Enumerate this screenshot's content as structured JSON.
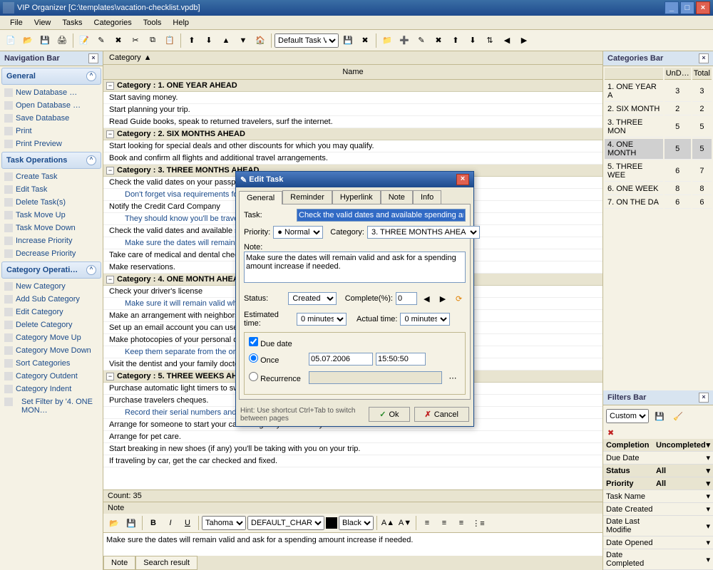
{
  "window": {
    "title": "VIP Organizer [C:\\templates\\vacation-checklist.vpdb]"
  },
  "menu": [
    "File",
    "View",
    "Tasks",
    "Categories",
    "Tools",
    "Help"
  ],
  "toolbar": {
    "taskview_label": "Default Task V"
  },
  "navbar": {
    "title": "Navigation Bar",
    "sections": {
      "general": {
        "title": "General",
        "items": [
          "New Database …",
          "Open Database …",
          "Save Database",
          "Print",
          "Print Preview"
        ]
      },
      "taskops": {
        "title": "Task Operations",
        "items": [
          "Create Task",
          "Edit Task",
          "Delete Task(s)",
          "Task Move Up",
          "Task Move Down",
          "Increase Priority",
          "Decrease Priority"
        ]
      },
      "catops": {
        "title": "Category Operati…",
        "items": [
          "New Category",
          "Add Sub Category",
          "Edit Category",
          "Delete Category",
          "Category Move Up",
          "Category Move Down",
          "Sort Categories",
          "Category Outdent",
          "Category Indent"
        ],
        "filter": "Set Filter by '4. ONE MON…"
      }
    }
  },
  "center": {
    "category_hdr": "Category",
    "name_col": "Name",
    "count": "Count: 35",
    "categories": [
      {
        "title": "Category : 1. ONE YEAR AHEAD",
        "tasks": [
          {
            "t": "Start saving money."
          },
          {
            "t": "Start planning your trip."
          },
          {
            "t": "Read Guide books, speak to returned travelers, surf the internet."
          }
        ]
      },
      {
        "title": "Category : 2. SIX MONTHS AHEAD",
        "tasks": [
          {
            "t": "Start looking for special deals and other discounts for which you may qualify."
          },
          {
            "t": "Book and confirm all flights and additional travel arrangements."
          }
        ]
      },
      {
        "title": "Category : 3. THREE MONTHS AHEAD",
        "tasks": [
          {
            "t": "Check the valid dates on your passport"
          },
          {
            "t": "Don't forget visa requirements for the co",
            "sub": true
          },
          {
            "t": "Notify the Credit Card Company"
          },
          {
            "t": "They should know you'll be traveling, so destination.",
            "sub": true
          },
          {
            "t": "Check the valid dates and available spendin"
          },
          {
            "t": "Make sure the dates will remain valid and needed.",
            "sub": true
          },
          {
            "t": "Take care of medical and dental checkups a"
          },
          {
            "t": "Make reservations."
          }
        ]
      },
      {
        "title": "Category : 4. ONE MONTH AHEAD",
        "tasks": [
          {
            "t": "Check your driver's license"
          },
          {
            "t": "Make sure it will remain valid while you're",
            "sub": true
          },
          {
            "t": "Make an arrangement with neighbors, frienc"
          },
          {
            "t": "Set up an email account you can use around"
          },
          {
            "t": "Make photocopies of your personal documen"
          },
          {
            "t": "Keep them separate from the originals w",
            "sub": true
          },
          {
            "t": "Visit the dentist and your family doctor."
          }
        ]
      },
      {
        "title": "Category : 5. THREE WEEKS AHEAD",
        "tasks": [
          {
            "t": "Purchase automatic light timers to switch on"
          },
          {
            "t": "Purchase travelers cheques."
          },
          {
            "t": "Record their serial numbers and keep a copy at home.",
            "sub": true
          },
          {
            "t": "Arrange for someone to start your car during very cold or very hot weather."
          },
          {
            "t": "Arrange for pet care."
          },
          {
            "t": "Start breaking in new shoes (if any) you'll be taking with you on your trip."
          },
          {
            "t": "If traveling by car, get the car checked and fixed."
          }
        ]
      }
    ]
  },
  "note": {
    "hdr": "Note",
    "font": "Tahoma",
    "charset": "DEFAULT_CHAR",
    "color": "Black",
    "body": "Make sure the dates will remain valid and ask for a spending amount increase if needed.",
    "tabs": [
      "Note",
      "Search result"
    ]
  },
  "catbar": {
    "title": "Categories Bar",
    "cols": [
      "",
      "UnD…",
      "Total"
    ],
    "rows": [
      {
        "n": "1. ONE YEAR A",
        "u": "3",
        "t": "3"
      },
      {
        "n": "2. SIX MONTH",
        "u": "2",
        "t": "2"
      },
      {
        "n": "3. THREE MON",
        "u": "5",
        "t": "5"
      },
      {
        "n": "4. ONE MONTH",
        "u": "5",
        "t": "5",
        "sel": true
      },
      {
        "n": "5. THREE WEE",
        "u": "6",
        "t": "7"
      },
      {
        "n": "6. ONE WEEK",
        "u": "8",
        "t": "8"
      },
      {
        "n": "7. ON THE DA",
        "u": "6",
        "t": "6"
      }
    ]
  },
  "filters": {
    "title": "Filters Bar",
    "custom": "Custom",
    "groups": [
      {
        "l": "Completion",
        "v": "Uncompleted",
        "hdr": true
      },
      {
        "l": "Due Date",
        "v": ""
      },
      {
        "l": "Status",
        "v": "All",
        "hdr": true
      },
      {
        "l": "Priority",
        "v": "All",
        "hdr": true
      },
      {
        "l": "Task Name",
        "v": ""
      },
      {
        "l": "Date Created",
        "v": ""
      },
      {
        "l": "Date Last Modifie",
        "v": ""
      },
      {
        "l": "Date Opened",
        "v": ""
      },
      {
        "l": "Date Completed",
        "v": ""
      }
    ]
  },
  "dialog": {
    "title": "Edit Task",
    "tabs": [
      "General",
      "Reminder",
      "Hyperlink",
      "Note",
      "Info"
    ],
    "labels": {
      "task": "Task:",
      "priority": "Priority:",
      "category": "Category:",
      "note": "Note:",
      "status": "Status:",
      "complete": "Complete(%):",
      "esttime": "Estimated time:",
      "acttime": "Actual time:",
      "duedate": "Due date",
      "once": "Once",
      "recurrence": "Recurrence"
    },
    "values": {
      "task": "Check the valid dates and available spending amount",
      "priority": "Normal",
      "category": "3. THREE MONTHS AHEA",
      "note": "Make sure the dates will remain valid and ask for a spending amount increase if needed.",
      "status": "Created",
      "complete": "0",
      "esttime": "0 minutes",
      "acttime": "0 minutes",
      "date": "05.07.2006",
      "time": "15:50:50"
    },
    "hint": "Hint: Use shortcut Ctrl+Tab to switch between pages",
    "ok": "Ok",
    "cancel": "Cancel"
  }
}
